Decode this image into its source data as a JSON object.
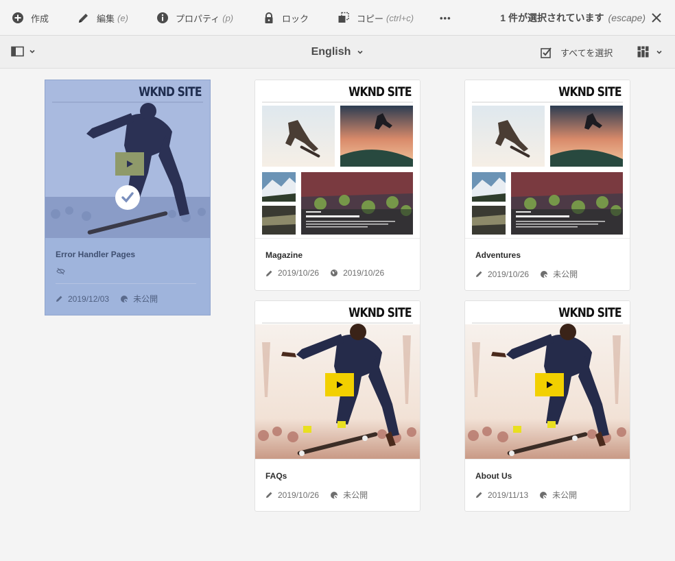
{
  "toolbar": {
    "create_label": "作成",
    "edit_label": "編集",
    "edit_shortcut": "(e)",
    "properties_label": "プロパティ",
    "properties_shortcut": "(p)",
    "lock_label": "ロック",
    "copy_label": "コピー",
    "copy_shortcut": "(ctrl+c)",
    "more_label": "•••",
    "selection_text": "1 件が選択されています",
    "selection_shortcut": "(escape)"
  },
  "subbar": {
    "language": "English",
    "select_all_label": "すべてを選択"
  },
  "colors": {
    "accent_selected": "#9fb4dc",
    "play_yellow": "#f2d000",
    "background": "#f4f4f4"
  },
  "cards": [
    {
      "brand": "WKND SITE",
      "title": "Error Handler Pages",
      "date": "2019/12/03",
      "publish": "未公開",
      "selected": true,
      "thumb": "skater-video"
    },
    {
      "brand": "WKND SITE",
      "title": "Magazine",
      "date": "2019/10/26",
      "publish": "2019/10/26",
      "selected": false,
      "thumb": "magazine-collage"
    },
    {
      "brand": "WKND SITE",
      "title": "Adventures",
      "date": "2019/10/26",
      "publish": "未公開",
      "selected": false,
      "thumb": "magazine-collage"
    },
    {
      "brand": "WKND SITE",
      "title": "FAQs",
      "date": "2019/10/26",
      "publish": "未公開",
      "selected": false,
      "thumb": "skater-video"
    },
    {
      "brand": "WKND SITE",
      "title": "About Us",
      "date": "2019/11/13",
      "publish": "未公開",
      "selected": false,
      "thumb": "skater-video"
    }
  ]
}
